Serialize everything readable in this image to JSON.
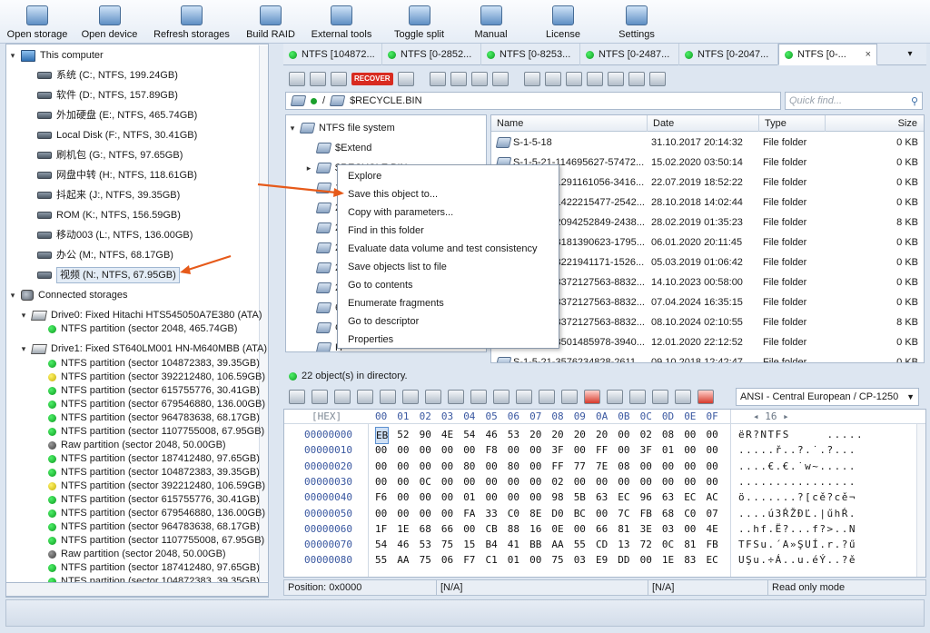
{
  "toolbar": [
    {
      "label": "Open storage",
      "icon": "open-storage-icon",
      "w": 82
    },
    {
      "label": "Open device",
      "icon": "open-device-icon",
      "w": 77
    },
    {
      "label": "Refresh storages",
      "icon": "refresh-icon",
      "w": 104
    },
    {
      "label": "Build RAID",
      "icon": "raid-icon",
      "w": 70
    },
    {
      "label": "External tools",
      "icon": "external-tools-icon",
      "w": 86
    },
    {
      "label": "Toggle split",
      "icon": "toggle-split-icon",
      "w": 85
    },
    {
      "label": "Manual",
      "icon": "manual-icon",
      "w": 73
    },
    {
      "label": "License",
      "icon": "license-icon",
      "w": 86
    },
    {
      "label": "Settings",
      "icon": "settings-icon",
      "w": 76
    }
  ],
  "left_tree": {
    "this_computer": "This computer",
    "drives": [
      "系统 (C:, NTFS, 199.24GB)",
      "软件 (D:, NTFS, 157.89GB)",
      "外加硬盘 (E:, NTFS, 465.74GB)",
      "Local Disk (F:, NTFS, 30.41GB)",
      "刷机包 (G:, NTFS, 97.65GB)",
      "网盘中转 (H:, NTFS, 118.61GB)",
      "抖起来 (J:, NTFS, 39.35GB)",
      "ROM (K:, NTFS, 156.59GB)",
      "移动003 (L:, NTFS, 136.00GB)",
      "办公 (M:, NTFS, 68.17GB)",
      "视频 (N:, NTFS, 67.95GB)"
    ],
    "connected_storages": "Connected storages",
    "drive0": "Drive0: Fixed Hitachi HTS545050A7E380 (ATA)",
    "drive0_parts": [
      {
        "label": "NTFS partition (sector 2048, 465.74GB)",
        "status": "green"
      }
    ],
    "drive1": "Drive1: Fixed ST640LM001 HN-M640MBB (ATA)",
    "drive1_parts": [
      {
        "label": "NTFS partition (sector 104872383, 39.35GB)",
        "status": "green"
      },
      {
        "label": "NTFS partition (sector 392212480, 106.59GB)",
        "status": "yellow"
      },
      {
        "label": "NTFS partition (sector 615755776, 30.41GB)",
        "status": "green"
      },
      {
        "label": "NTFS partition (sector 679546880, 136.00GB)",
        "status": "green"
      },
      {
        "label": "NTFS partition (sector 964783638, 68.17GB)",
        "status": "green"
      },
      {
        "label": "NTFS partition (sector 1107755008, 67.95GB)",
        "status": "green"
      },
      {
        "label": "Raw partition (sector 2048, 50.00GB)",
        "status": "gray"
      },
      {
        "label": "NTFS partition (sector 187412480, 97.65GB)",
        "status": "green"
      },
      {
        "label": "NTFS partition (sector 104872383, 39.35GB)",
        "status": "green"
      },
      {
        "label": "NTFS partition (sector 392212480, 106.59GB)",
        "status": "yellow"
      },
      {
        "label": "NTFS partition (sector 615755776, 30.41GB)",
        "status": "green"
      },
      {
        "label": "NTFS partition (sector 679546880, 136.00GB)",
        "status": "green"
      },
      {
        "label": "NTFS partition (sector 964783638, 68.17GB)",
        "status": "green"
      },
      {
        "label": "NTFS partition (sector 1107755008, 67.95GB)",
        "status": "green"
      },
      {
        "label": "Raw partition (sector 2048, 50.00GB)",
        "status": "gray"
      },
      {
        "label": "NTFS partition (sector 187412480, 97.65GB)",
        "status": "green"
      },
      {
        "label": "NTFS partition (sector 104872383, 39.35GB)",
        "status": "green"
      }
    ]
  },
  "tabs": [
    "NTFS [104872...",
    "NTFS [0-2852...",
    "NTFS [0-8253...",
    "NTFS [0-2487...",
    "NTFS [0-2047...",
    "NTFS [0-..."
  ],
  "tab_close": "×",
  "tab_ctrl": "▾",
  "recover_label": "RECOVER",
  "path": {
    "sep": "/",
    "current": "$RECYCLE.BIN"
  },
  "quick_find_placeholder": "Quick find...",
  "fs_tree": {
    "root": "NTFS file system",
    "items": [
      "$Extend",
      "$RECYCLE.BIN",
      "1",
      "2",
      "2",
      "2",
      "2",
      "2",
      "6",
      "G",
      "H",
      "N"
    ]
  },
  "file_list": {
    "headers": {
      "name": "Name",
      "date": "Date",
      "type": "Type",
      "size": "Size"
    },
    "rows": [
      {
        "name": "S-1-5-18",
        "date": "31.10.2017 20:14:32",
        "type": "File folder",
        "size": "0 KB"
      },
      {
        "name": "S-1-5-21-114695627-57472...",
        "date": "15.02.2020 03:50:14",
        "type": "File folder",
        "size": "0 KB"
      },
      {
        "name": "S-1-5-21-1291161056-3416...",
        "date": "22.07.2019 18:52:22",
        "type": "File folder",
        "size": "0 KB"
      },
      {
        "name": "S-1-5-21-1422215477-2542...",
        "date": "28.10.2018 14:02:44",
        "type": "File folder",
        "size": "0 KB"
      },
      {
        "name": "S-1-5-21-2094252849-2438...",
        "date": "28.02.2019 01:35:23",
        "type": "File folder",
        "size": "8 KB"
      },
      {
        "name": "S-1-5-21-3181390623-1795...",
        "date": "06.01.2020 20:11:45",
        "type": "File folder",
        "size": "0 KB"
      },
      {
        "name": "S-1-5-21-3221941171-1526...",
        "date": "05.03.2019 01:06:42",
        "type": "File folder",
        "size": "0 KB"
      },
      {
        "name": "S-1-5-21-3372127563-8832...",
        "date": "14.10.2023 00:58:00",
        "type": "File folder",
        "size": "0 KB"
      },
      {
        "name": "S-1-5-21-3372127563-8832...",
        "date": "07.04.2024 16:35:15",
        "type": "File folder",
        "size": "0 KB"
      },
      {
        "name": "S-1-5-21-3372127563-8832...",
        "date": "08.10.2024 02:10:55",
        "type": "File folder",
        "size": "8 KB"
      },
      {
        "name": "S-1-5-21-3501485978-3940...",
        "date": "12.01.2020 22:12:52",
        "type": "File folder",
        "size": "0 KB"
      },
      {
        "name": "S-1-5-21-3576234828-2611...",
        "date": "09.10.2018 12:42:47",
        "type": "File folder",
        "size": "0 KB"
      }
    ]
  },
  "context_menu": [
    "Explore",
    "Save this object to...",
    "Copy with parameters...",
    "Find in this folder",
    "Evaluate data volume and test consistency",
    "Save objects list to file",
    "Go to contents",
    "Enumerate fragments",
    "Go to descriptor",
    "Properties"
  ],
  "dir_status": "22 object(s) in directory.",
  "encoding": "ANSI - Central European / CP-1250",
  "hex": {
    "label": "[HEX]",
    "columns": [
      "00",
      "01",
      "02",
      "03",
      "04",
      "05",
      "06",
      "07",
      "08",
      "09",
      "0A",
      "0B",
      "0C",
      "0D",
      "0E",
      "0F"
    ],
    "nav": "◂ 16 ▸",
    "lines": [
      {
        "offset": "00000000",
        "bytes": [
          "EB",
          "52",
          "90",
          "4E",
          "54",
          "46",
          "53",
          "20",
          "20",
          "20",
          "20",
          "00",
          "02",
          "08",
          "00",
          "00"
        ],
        "ascii": "ëR?NTFS     ....."
      },
      {
        "offset": "00000010",
        "bytes": [
          "00",
          "00",
          "00",
          "00",
          "00",
          "F8",
          "00",
          "00",
          "3F",
          "00",
          "FF",
          "00",
          "3F",
          "01",
          "00",
          "00"
        ],
        "ascii": ".....ř..?.˙.?..."
      },
      {
        "offset": "00000020",
        "bytes": [
          "00",
          "00",
          "00",
          "00",
          "80",
          "00",
          "80",
          "00",
          "FF",
          "77",
          "7E",
          "08",
          "00",
          "00",
          "00",
          "00"
        ],
        "ascii": "....€.€.˙w~....."
      },
      {
        "offset": "00000030",
        "bytes": [
          "00",
          "00",
          "0C",
          "00",
          "00",
          "00",
          "00",
          "00",
          "02",
          "00",
          "00",
          "00",
          "00",
          "00",
          "00",
          "00"
        ],
        "ascii": "................"
      },
      {
        "offset": "00000040",
        "bytes": [
          "F6",
          "00",
          "00",
          "00",
          "01",
          "00",
          "00",
          "00",
          "98",
          "5B",
          "63",
          "EC",
          "96",
          "63",
          "EC",
          "AC"
        ],
        "ascii": "ö.......?[cě?cě¬"
      },
      {
        "offset": "00000050",
        "bytes": [
          "00",
          "00",
          "00",
          "00",
          "FA",
          "33",
          "C0",
          "8E",
          "D0",
          "BC",
          "00",
          "7C",
          "FB",
          "68",
          "C0",
          "07"
        ],
        "ascii": "....ú3ŔŽĐĽ.|űhŔ."
      },
      {
        "offset": "00000060",
        "bytes": [
          "1F",
          "1E",
          "68",
          "66",
          "00",
          "CB",
          "88",
          "16",
          "0E",
          "00",
          "66",
          "81",
          "3E",
          "03",
          "00",
          "4E"
        ],
        "ascii": "..hf.Ë?...f?>..N"
      },
      {
        "offset": "00000070",
        "bytes": [
          "54",
          "46",
          "53",
          "75",
          "15",
          "B4",
          "41",
          "BB",
          "AA",
          "55",
          "CD",
          "13",
          "72",
          "0C",
          "81",
          "FB"
        ],
        "ascii": "TFSu.´A»ŞUÍ.r.?ű"
      },
      {
        "offset": "00000080",
        "bytes": [
          "55",
          "AA",
          "75",
          "06",
          "F7",
          "C1",
          "01",
          "00",
          "75",
          "03",
          "E9",
          "DD",
          "00",
          "1E",
          "83",
          "EC"
        ],
        "ascii": "UŞu.÷Á..u.éÝ..?ě"
      }
    ]
  },
  "bottom_status": {
    "position": "Position: 0x0000",
    "na1": "[N/A]",
    "na2": "[N/A]",
    "mode": "Read only mode"
  }
}
